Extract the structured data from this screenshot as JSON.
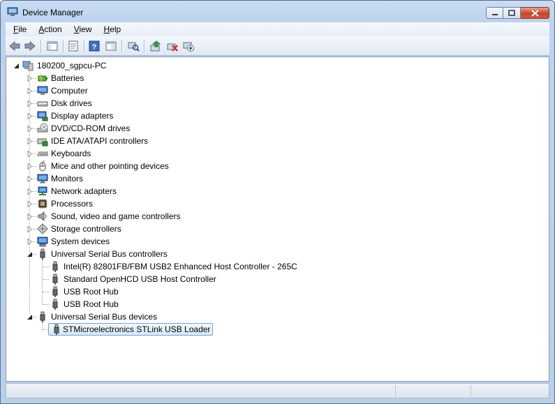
{
  "window": {
    "title": "Device Manager"
  },
  "menu": [
    {
      "key": "F",
      "rest": "ile"
    },
    {
      "key": "A",
      "rest": "ction"
    },
    {
      "key": "V",
      "rest": "iew"
    },
    {
      "key": "H",
      "rest": "elp"
    }
  ],
  "toolbar": {
    "buttons": [
      "back-icon",
      "forward-icon",
      "show-hide-console-tree-icon",
      "properties-icon",
      "help-icon",
      "console-view-icon",
      "scan-hardware-icon",
      "update-driver-icon",
      "uninstall-icon",
      "disable-device-icon"
    ]
  },
  "tree": {
    "root": "180200_sgpcu-PC",
    "categories": [
      {
        "label": "Batteries",
        "icon": "battery-icon"
      },
      {
        "label": "Computer",
        "icon": "computer-icon"
      },
      {
        "label": "Disk drives",
        "icon": "disk-drive-icon"
      },
      {
        "label": "Display adapters",
        "icon": "display-adapter-icon"
      },
      {
        "label": "DVD/CD-ROM drives",
        "icon": "dvd-drive-icon"
      },
      {
        "label": "IDE ATA/ATAPI controllers",
        "icon": "ide-controller-icon"
      },
      {
        "label": "Keyboards",
        "icon": "keyboard-icon"
      },
      {
        "label": "Mice and other pointing devices",
        "icon": "mouse-icon"
      },
      {
        "label": "Monitors",
        "icon": "monitor-icon"
      },
      {
        "label": "Network adapters",
        "icon": "network-adapter-icon"
      },
      {
        "label": "Processors",
        "icon": "processor-icon"
      },
      {
        "label": "Sound, video and game controllers",
        "icon": "speaker-icon"
      },
      {
        "label": "Storage controllers",
        "icon": "storage-controller-icon"
      },
      {
        "label": "System devices",
        "icon": "system-device-icon"
      },
      {
        "label": "Universal Serial Bus controllers",
        "icon": "usb-icon",
        "expanded": true,
        "children": [
          "Intel(R) 82801FB/FBM USB2 Enhanced Host Controller - 265C",
          "Standard OpenHCD USB Host Controller",
          "USB Root Hub",
          "USB Root Hub"
        ]
      },
      {
        "label": "Universal Serial Bus devices",
        "icon": "usb-icon",
        "expanded": true,
        "children": [
          "STMicroelectronics STLink USB Loader"
        ],
        "selected_child": 0
      }
    ]
  },
  "colors": {
    "selection_border": "#7da2ce",
    "frame": "#b9d0ec"
  }
}
